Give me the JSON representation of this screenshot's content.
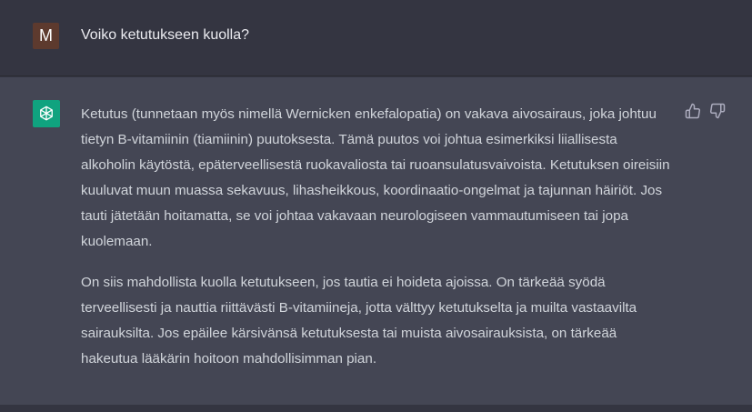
{
  "user_message": {
    "avatar_letter": "M",
    "text": "Voiko ketutukseen kuolla?"
  },
  "assistant_message": {
    "paragraphs": [
      "Ketutus (tunnetaan myös nimellä Wernicken enkefalopatia) on vakava aivosairaus, joka johtuu tietyn B-vitamiinin (tiamiinin) puutoksesta. Tämä puutos voi johtua esimerkiksi liiallisesta alkoholin käytöstä, epäterveellisestä ruokavaliosta tai ruoansulatusvaivoista. Ketutuksen oireisiin kuuluvat muun muassa sekavuus, lihasheikkous, koordinaatio-ongelmat ja tajunnan häiriöt. Jos tauti jätetään hoitamatta, se voi johtaa vakavaan neurologiseen vammautumiseen tai jopa kuolemaan.",
      "On siis mahdollista kuolla ketutukseen, jos tautia ei hoideta ajoissa. On tärkeää syödä terveellisesti ja nauttia riittävästi B-vitamiineja, jotta välttyy ketutukselta ja muilta vastaavilta sairauksilta. Jos epäilee kärsivänsä ketutuksesta tai muista aivosairauksista, on tärkeää hakeutua lääkärin hoitoon mahdollisimman pian."
    ]
  },
  "icons": {
    "assistant_avatar": "openai-logo-icon",
    "thumbs_up": "thumbs-up-icon",
    "thumbs_down": "thumbs-down-icon"
  },
  "colors": {
    "user_bg": "#343541",
    "assistant_bg": "#444654",
    "user_avatar": "#5d3a2e",
    "assistant_avatar": "#10a37f"
  }
}
